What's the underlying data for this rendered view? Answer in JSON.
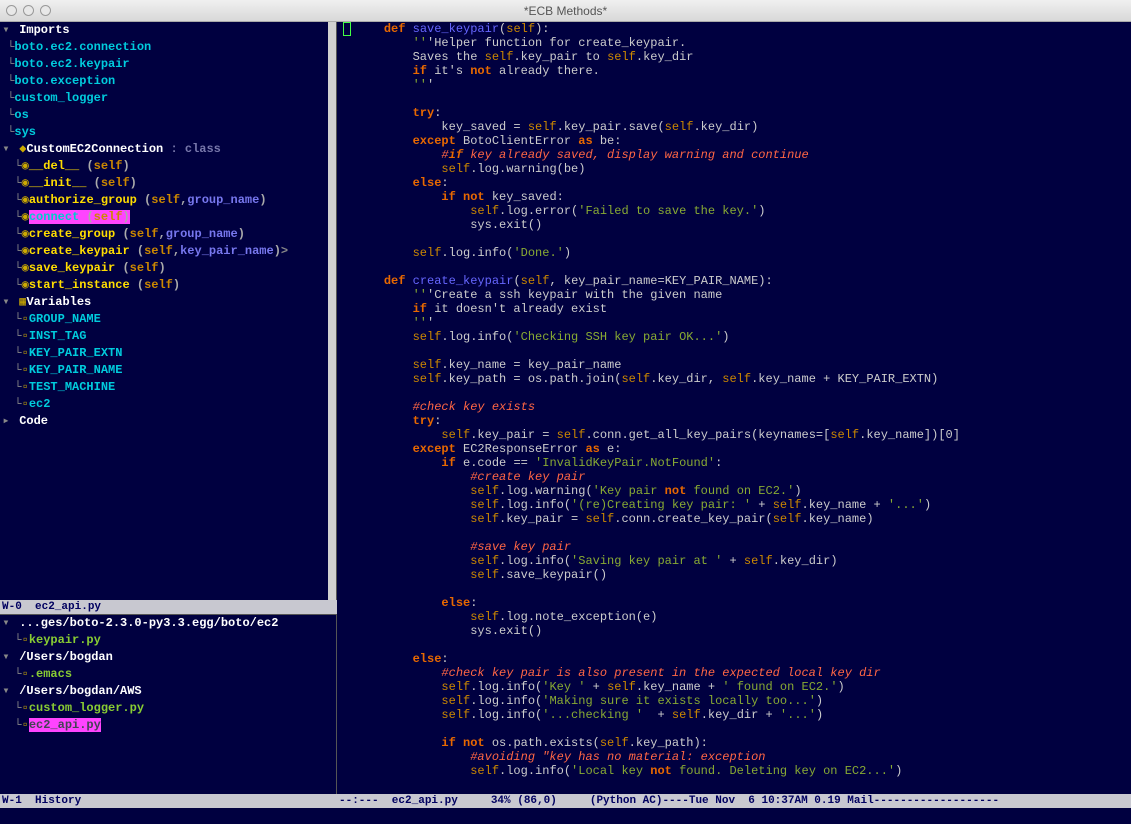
{
  "titlebar": {
    "title": "*ECB Methods*"
  },
  "methods_panel": {
    "status": "W-0  ec2_api.py",
    "sections": {
      "imports_heading": "Imports",
      "class_heading": "CustomEC2Connection : class",
      "variables_heading": "Variables",
      "code_heading": "Code"
    },
    "imports": [
      "boto.ec2.connection",
      "boto.ec2.keypair",
      "boto.exception",
      "custom_logger",
      "os",
      "sys"
    ],
    "methods": [
      {
        "name": "__del__",
        "params": "(self)"
      },
      {
        "name": "__init__",
        "params": "(self)"
      },
      {
        "name": "authorize_group",
        "params": "(self,group_name)"
      },
      {
        "name": "connect",
        "params": "(self)",
        "highlighted": true
      },
      {
        "name": "create_group",
        "params": "(self,group_name)"
      },
      {
        "name": "create_keypair",
        "params": "(self,key_pair_name)",
        "overflow": ">"
      },
      {
        "name": "save_keypair",
        "params": "(self)"
      },
      {
        "name": "start_instance",
        "params": "(self)"
      }
    ],
    "variables": [
      "GROUP_NAME",
      "INST_TAG",
      "KEY_PAIR_EXTN",
      "KEY_PAIR_NAME",
      "TEST_MACHINE",
      "ec2"
    ]
  },
  "history_panel": {
    "status": "W-1  History",
    "entries": [
      {
        "type": "dir",
        "label": "...ges/boto-2.3.0-py3.3.egg/boto/ec2"
      },
      {
        "type": "file",
        "label": "keypair.py",
        "indent": 1
      },
      {
        "type": "dir",
        "label": "/Users/bogdan"
      },
      {
        "type": "file",
        "label": ".emacs",
        "indent": 1
      },
      {
        "type": "dir",
        "label": "/Users/bogdan/AWS"
      },
      {
        "type": "file",
        "label": "custom_logger.py",
        "indent": 1
      },
      {
        "type": "file",
        "label": "ec2_api.py",
        "indent": 1,
        "highlighted": true
      }
    ]
  },
  "code": {
    "status": "--:---  ec2_api.py     34% (86,0)     (Python AC)----Tue Nov  6 10:37AM 0.19 Mail-------------------",
    "lines": [
      "    def save_keypair(self):",
      "        '''Helper function for create_keypair.",
      "        Saves the self.key_pair to self.key_dir",
      "        if it's not already there.",
      "        '''",
      "",
      "        try:",
      "            key_saved = self.key_pair.save(self.key_dir)",
      "        except BotoClientError as be:",
      "            #if key already saved, display warning and continue",
      "            self.log.warning(be)",
      "        else:",
      "            if not key_saved:",
      "                self.log.error('Failed to save the key.')",
      "                sys.exit()",
      "",
      "        self.log.info('Done.')",
      "",
      "    def create_keypair(self, key_pair_name=KEY_PAIR_NAME):",
      "        '''Create a ssh keypair with the given name",
      "        if it doesn't already exist",
      "        '''",
      "        self.log.info('Checking SSH key pair OK...')",
      "",
      "        self.key_name = key_pair_name",
      "        self.key_path = os.path.join(self.key_dir, self.key_name + KEY_PAIR_EXTN)",
      "",
      "        #check key exists",
      "        try:",
      "            self.key_pair = self.conn.get_all_key_pairs(keynames=[self.key_name])[0]",
      "        except EC2ResponseError as e:",
      "            if e.code == 'InvalidKeyPair.NotFound':",
      "                #create key pair",
      "                self.log.warning('Key pair not found on EC2.')",
      "                self.log.info('(re)Creating key pair: ' + self.key_name + '...')",
      "                self.key_pair = self.conn.create_key_pair(self.key_name)",
      "",
      "                #save key pair",
      "                self.log.info('Saving key pair at ' + self.key_dir)",
      "                self.save_keypair()",
      "",
      "            else:",
      "                self.log.note_exception(e)",
      "                sys.exit()",
      "",
      "        else:",
      "            #check key pair is also present in the expected local key dir",
      "            self.log.info('Key ' + self.key_name + ' found on EC2.')",
      "            self.log.info('Making sure it exists locally too...')",
      "            self.log.info('...checking '  + self.key_dir + '...')",
      "",
      "            if not os.path.exists(self.key_path):",
      "                #avoiding \"key has no material: exception",
      "                self.log.info('Local key not found. Deleting key on EC2...')"
    ]
  },
  "minibuffer": ""
}
